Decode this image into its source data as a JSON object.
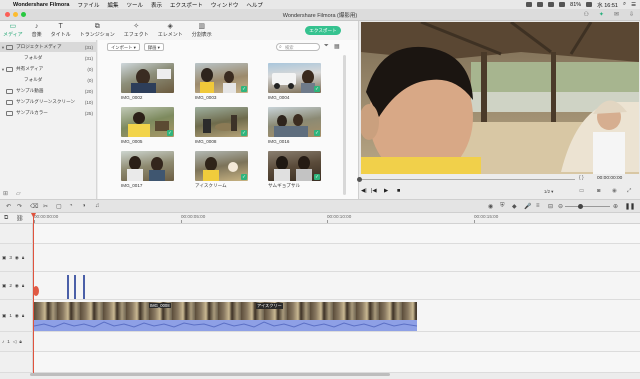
{
  "menubar": {
    "apple": "",
    "app_name": "Wondershare Filmora",
    "items": [
      "ファイル",
      "編集",
      "ツール",
      "表示",
      "エクスポート",
      "ウィンドウ",
      "ヘルプ"
    ],
    "battery": "81%",
    "clock": "水 16:51"
  },
  "window": {
    "title": "Wondershare Filmora (爆影用)"
  },
  "toolbar": {
    "tabs": [
      {
        "label": "メディア",
        "icon": "media-folder-icon"
      },
      {
        "label": "音楽",
        "icon": "music-note-icon"
      },
      {
        "label": "タイトル",
        "icon": "title-text-icon"
      },
      {
        "label": "トランジション",
        "icon": "transition-icon"
      },
      {
        "label": "エフェクト",
        "icon": "effect-icon"
      },
      {
        "label": "エレメント",
        "icon": "element-icon"
      },
      {
        "label": "分割表示",
        "icon": "split-screen-icon"
      }
    ],
    "export_label": "エクスポート"
  },
  "sidebar": {
    "items": [
      {
        "label": "プロジェクトメディア",
        "count": "(31)",
        "expanded": true
      },
      {
        "label": "フォルダ",
        "count": "(31)",
        "child": true
      },
      {
        "label": "共有メディア",
        "count": "(0)",
        "expanded": true
      },
      {
        "label": "フォルダ",
        "count": "(0)",
        "child": true
      },
      {
        "label": "サンプル動画",
        "count": "(20)"
      },
      {
        "label": "サンプルグリーンスクリーン",
        "count": "(10)"
      },
      {
        "label": "サンプルカラー",
        "count": "(25)"
      }
    ]
  },
  "media": {
    "import_label": "インポート",
    "record_label": "録画",
    "search_placeholder": "検索",
    "thumbnails": [
      {
        "label": "IMG_0002",
        "checked": false
      },
      {
        "label": "IMG_0003",
        "checked": true
      },
      {
        "label": "IMG_0004",
        "checked": true
      },
      {
        "label": "IMG_0005",
        "checked": true
      },
      {
        "label": "IMG_0008",
        "checked": true
      },
      {
        "label": "IMG_0016",
        "checked": true
      },
      {
        "label": "IMG_0017",
        "checked": false
      },
      {
        "label": "アイスクリーム",
        "checked": true
      },
      {
        "label": "サムギョプサル",
        "checked": true
      }
    ]
  },
  "preview": {
    "timecode": "00:00:00:00",
    "quality": "1/2"
  },
  "timeline": {
    "ruler": [
      "00:00:00:00",
      "00:00:05:00",
      "00:00:10:00",
      "00:00:15:00"
    ],
    "tracks": [
      {
        "label": "3"
      },
      {
        "label": "2"
      },
      {
        "label": "1"
      },
      {
        "label": "1"
      }
    ],
    "clip_labels": [
      "IMG_0008",
      "アイスクリー"
    ]
  }
}
